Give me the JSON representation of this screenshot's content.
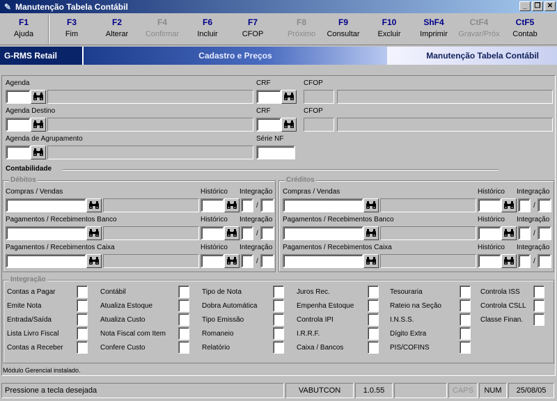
{
  "window": {
    "title": "Manutenção Tabela Contábil",
    "buttons": [
      "_",
      "❐",
      "✕"
    ]
  },
  "toolbar": [
    {
      "key": "F1",
      "label": "Ajuda",
      "enabled": true
    },
    {
      "key": "F3",
      "label": "Fim",
      "enabled": true
    },
    {
      "key": "F2",
      "label": "Alterar",
      "enabled": true
    },
    {
      "key": "F4",
      "label": "Confirmar",
      "enabled": false
    },
    {
      "key": "F6",
      "label": "Incluir",
      "enabled": true
    },
    {
      "key": "F7",
      "label": "CFOP",
      "enabled": true
    },
    {
      "key": "F8",
      "label": "Próximo",
      "enabled": false
    },
    {
      "key": "F9",
      "label": "Consultar",
      "enabled": true
    },
    {
      "key": "F10",
      "label": "Excluir",
      "enabled": true
    },
    {
      "key": "ShF4",
      "label": "Imprimir",
      "enabled": true
    },
    {
      "key": "CtF4",
      "label": "Gravar/Próx",
      "enabled": false
    },
    {
      "key": "CtF5",
      "label": "Contab",
      "enabled": true
    }
  ],
  "banner": {
    "app": "G-RMS Retail",
    "module": "Cadastro e Preços",
    "screen": "Manutenção Tabela Contábil"
  },
  "form": {
    "agenda": "Agenda",
    "crf": "CRF",
    "cfop": "CFOP",
    "agenda_destino": "Agenda Destino",
    "crf2": "CRF",
    "cfop2": "CFOP",
    "agenda_agrupamento": "Agenda de Agrupamento",
    "serie_nf": "Série NF"
  },
  "contabilidade": {
    "title": "Contabilidade",
    "debitos": {
      "title": "Débitos",
      "rows": [
        {
          "label": "Compras / Vendas",
          "historico": "Histórico",
          "integracao": "Integração"
        },
        {
          "label": "Pagamentos / Recebimentos Banco",
          "historico": "Histórico",
          "integracao": "Integração"
        },
        {
          "label": "Pagamentos / Recebimentos Caixa",
          "historico": "Histórico",
          "integracao": "Integração"
        }
      ]
    },
    "creditos": {
      "title": "Créditos",
      "rows": [
        {
          "label": "Compras / Vendas",
          "historico": "Histórico",
          "integracao": "Integração"
        },
        {
          "label": "Pagamentos / Recebimentos Banco",
          "historico": "Histórico",
          "integracao": "Integração"
        },
        {
          "label": "Pagamentos / Recebimentos Caixa",
          "historico": "Histórico",
          "integracao": "Integração"
        }
      ]
    },
    "slash": "/"
  },
  "integracao": {
    "title": "Integração",
    "columns": [
      [
        "Contas a Pagar",
        "Emite Nota",
        "Entrada/Saída",
        "Lista Livro Fiscal",
        "Contas a Receber"
      ],
      [
        "Contábil",
        "Atualiza Estoque",
        "Atualiza Custo",
        "Nota Fiscal com Item",
        "Confere Custo"
      ],
      [
        "Tipo de Nota",
        "Dobra Automática",
        "Tipo Emissão",
        "Romaneio",
        "Relatório"
      ],
      [
        "Juros Rec.",
        "Empenha Estoque",
        "Controla IPI",
        "I.R.R.F.",
        "Caixa / Bancos"
      ],
      [
        "Tesouraria",
        "Rateio na Seção",
        "I.N.S.S.",
        "Dígito Extra",
        "PIS/COFINS"
      ],
      [
        "Controla ISS",
        "Controla CSLL",
        "Classe Finan."
      ]
    ]
  },
  "footer_note": "Módulo Gerencial instalado.",
  "status": {
    "message": "Pressione a tecla desejada",
    "user": "VABUTCON",
    "version": "1.0.55",
    "caps": "CAPS",
    "num": "NUM",
    "date": "25/08/05"
  }
}
